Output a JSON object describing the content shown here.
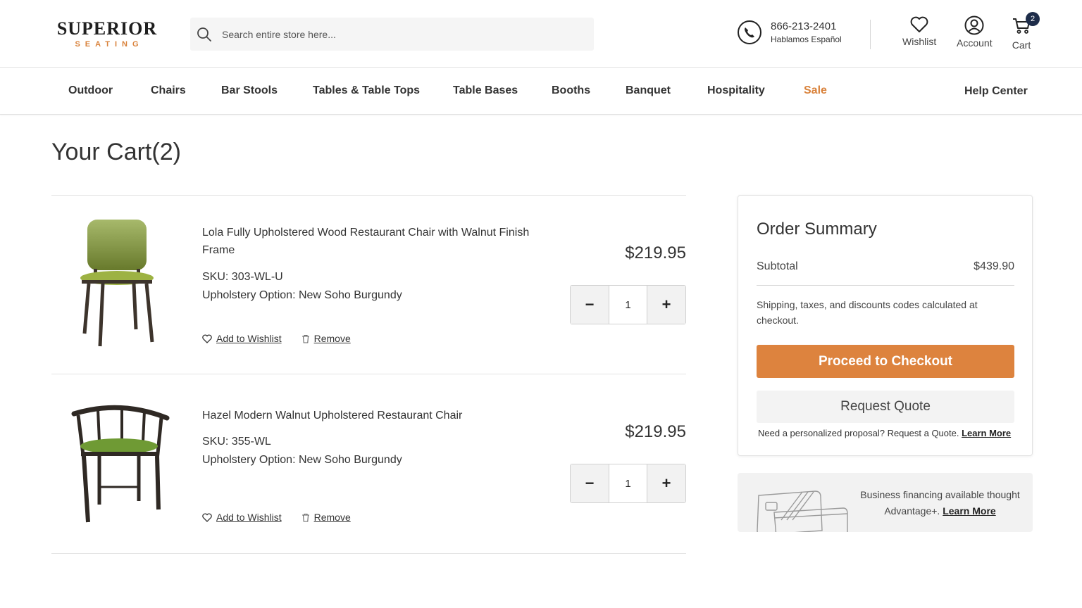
{
  "brand": {
    "name": "SUPERIOR",
    "tagline": "SEATING"
  },
  "search": {
    "placeholder": "Search entire store here..."
  },
  "contact": {
    "phone": "866-213-2401",
    "note": "Hablamos Español"
  },
  "header_actions": {
    "wishlist": "Wishlist",
    "account": "Account",
    "cart": "Cart",
    "cart_count": "2"
  },
  "nav": {
    "items": [
      "Outdoor",
      "Chairs",
      "Bar Stools",
      "Tables & Table Tops",
      "Table Bases",
      "Booths",
      "Banquet",
      "Hospitality",
      "Sale"
    ],
    "help": "Help Center"
  },
  "page": {
    "title": "Your Cart(2)"
  },
  "cart": {
    "items": [
      {
        "name": "Lola Fully Upholstered Wood Restaurant Chair with Walnut Finish Frame",
        "sku": "SKU: 303-WL-U",
        "option": "Upholstery Option: New Soho Burgundy",
        "price": "$219.95",
        "qty": "1",
        "wishlist": "Add to Wishlist",
        "remove": "Remove"
      },
      {
        "name": "Hazel Modern Walnut Upholstered Restaurant Chair",
        "sku": "SKU: 355-WL",
        "option": "Upholstery Option: New Soho Burgundy",
        "price": "$219.95",
        "qty": "1",
        "wishlist": "Add to Wishlist",
        "remove": "Remove"
      }
    ],
    "qty_minus": "−",
    "qty_plus": "+"
  },
  "summary": {
    "title": "Order Summary",
    "subtotal_label": "Subtotal",
    "subtotal_value": "$439.90",
    "shipping_note": "Shipping, taxes, and discounts codes calculated at checkout.",
    "checkout": "Proceed to Checkout",
    "quote": "Request Quote",
    "quote_note": "Need a personalized proposal? Request a Quote.",
    "learn_more": "Learn More"
  },
  "financing": {
    "text": "Business financing available thought Advantage+.",
    "learn_more": "Learn More"
  },
  "colors": {
    "accent": "#dd833e",
    "badge": "#1e2d4a",
    "upholstery": "#8aa23a"
  }
}
